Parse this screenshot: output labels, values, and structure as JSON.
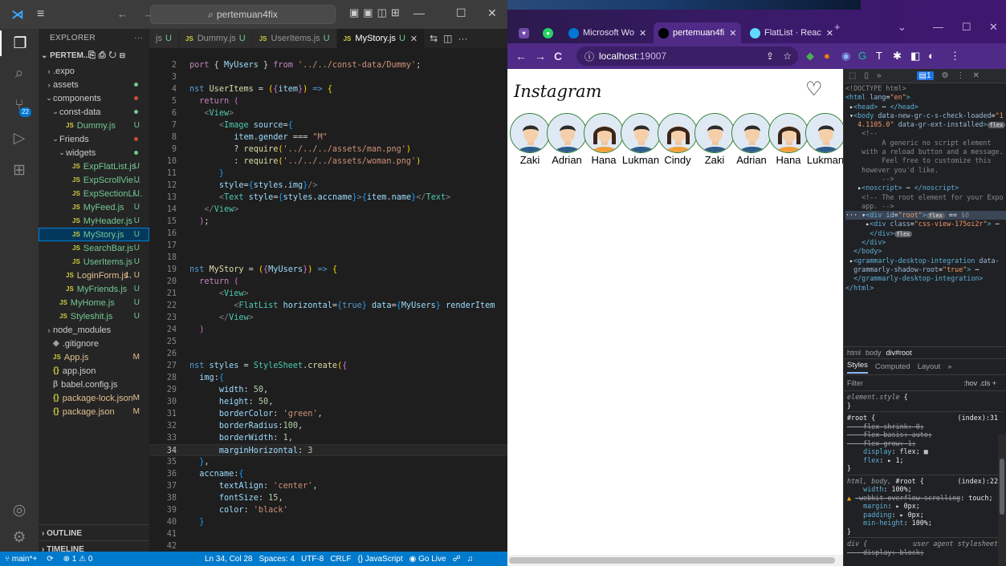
{
  "vscode": {
    "search": "pertemuan4fix",
    "explorer_title": "EXPLORER",
    "project": "PERTEM...",
    "tree": [
      {
        "label": ".expo",
        "indent": 1,
        "chev": "›",
        "status": "",
        "dot": ""
      },
      {
        "label": "assets",
        "indent": 1,
        "chev": "›",
        "status": "",
        "dot": "#73c991"
      },
      {
        "label": "components",
        "indent": 1,
        "chev": "⌄",
        "status": "",
        "dot": "#c74e39"
      },
      {
        "label": "const-data",
        "indent": 2,
        "chev": "⌄",
        "status": "",
        "dot": "#73c991"
      },
      {
        "label": "Dummy.js",
        "indent": 3,
        "chev": "",
        "js": true,
        "status": "U",
        "dot": ""
      },
      {
        "label": "Friends",
        "indent": 2,
        "chev": "⌄",
        "status": "",
        "dot": "#c74e39"
      },
      {
        "label": "widgets",
        "indent": 3,
        "chev": "⌄",
        "status": "",
        "dot": "#73c991"
      },
      {
        "label": "ExpFlatList.js",
        "indent": 4,
        "chev": "",
        "js": true,
        "status": "U",
        "dot": ""
      },
      {
        "label": "ExpScrollVie...",
        "indent": 4,
        "chev": "",
        "js": true,
        "status": "U",
        "dot": ""
      },
      {
        "label": "ExpSectionLi...",
        "indent": 4,
        "chev": "",
        "js": true,
        "status": "U",
        "dot": ""
      },
      {
        "label": "MyFeed.js",
        "indent": 4,
        "chev": "",
        "js": true,
        "status": "U",
        "dot": ""
      },
      {
        "label": "MyHeader.js",
        "indent": 4,
        "chev": "",
        "js": true,
        "status": "U",
        "dot": ""
      },
      {
        "label": "MyStory.js",
        "indent": 4,
        "chev": "",
        "js": true,
        "status": "U",
        "dot": "",
        "selected": true
      },
      {
        "label": "SearchBar.js",
        "indent": 4,
        "chev": "",
        "js": true,
        "status": "U",
        "dot": ""
      },
      {
        "label": "UserItems.js",
        "indent": 4,
        "chev": "",
        "js": true,
        "status": "U",
        "dot": ""
      },
      {
        "label": "LoginForm.js",
        "indent": 3,
        "chev": "",
        "js": true,
        "status": "1, U",
        "dot": "",
        "statusClass": "stat-1U"
      },
      {
        "label": "MyFriends.js",
        "indent": 3,
        "chev": "",
        "js": true,
        "status": "U",
        "dot": ""
      },
      {
        "label": "MyHome.js",
        "indent": 2,
        "chev": "",
        "js": true,
        "status": "U",
        "dot": ""
      },
      {
        "label": "Styleshit.js",
        "indent": 2,
        "chev": "",
        "js": true,
        "status": "U",
        "dot": ""
      },
      {
        "label": "node_modules",
        "indent": 1,
        "chev": "›",
        "status": "",
        "dot": ""
      },
      {
        "label": ".gitignore",
        "indent": 1,
        "chev": "",
        "icon": "◈",
        "status": "",
        "dot": ""
      },
      {
        "label": "App.js",
        "indent": 1,
        "chev": "",
        "js": true,
        "status": "M",
        "dot": "",
        "statusClass": "stat-M"
      },
      {
        "label": "app.json",
        "indent": 1,
        "chev": "",
        "json": true,
        "status": "",
        "dot": ""
      },
      {
        "label": "babel.config.js",
        "indent": 1,
        "chev": "",
        "icon": "β",
        "status": "",
        "dot": ""
      },
      {
        "label": "package-lock.json",
        "indent": 1,
        "chev": "",
        "json": true,
        "status": "M",
        "dot": "",
        "statusClass": "stat-M"
      },
      {
        "label": "package.json",
        "indent": 1,
        "chev": "",
        "json": true,
        "status": "M",
        "dot": "",
        "statusClass": "stat-M"
      }
    ],
    "outline": "OUTLINE",
    "timeline": "TIMELINE",
    "tabs": [
      {
        "label": "js",
        "u": "U",
        "js": false,
        "active": false
      },
      {
        "label": "Dummy.js",
        "u": "U",
        "js": true,
        "active": false
      },
      {
        "label": "UserItems.js",
        "u": "U",
        "js": true,
        "active": false
      },
      {
        "label": "MyStory.js",
        "u": "U",
        "js": true,
        "active": true
      }
    ],
    "status": {
      "branch": "main*+",
      "errors": "⊗ 1 ⚠ 0",
      "position": "Ln 34, Col 28",
      "spaces": "Spaces: 4",
      "encoding": "UTF-8",
      "eol": "CRLF",
      "language": "{} JavaScript",
      "golive": "Go Live"
    }
  },
  "chrome": {
    "tabs": [
      {
        "label": "Microsoft Wo",
        "fav": "#0078d4",
        "active": false
      },
      {
        "label": "pertemuan4fi",
        "fav": "#000",
        "active": true
      },
      {
        "label": "FlatList · Reac",
        "fav": "#61dafb",
        "active": false
      }
    ],
    "url_host": "localhost",
    "url_port": ":19007",
    "page": {
      "logo": "Instagram",
      "stories": [
        {
          "name": "Zaki",
          "gender": "M"
        },
        {
          "name": "Adrian",
          "gender": "M"
        },
        {
          "name": "Hana",
          "gender": "F"
        },
        {
          "name": "Lukman",
          "gender": "M"
        },
        {
          "name": "Cindy",
          "gender": "F"
        },
        {
          "name": "Zaki",
          "gender": "M"
        },
        {
          "name": "Adrian",
          "gender": "M"
        },
        {
          "name": "Hana",
          "gender": "F"
        },
        {
          "name": "Lukman",
          "gender": "M"
        }
      ]
    },
    "devtools": {
      "breadcrumb": [
        "html",
        "body",
        "div#root"
      ],
      "tabs": [
        "Styles",
        "Computed",
        "Layout",
        "»"
      ],
      "filter": "Filter",
      "filter_right": ":hov  .cls  +"
    }
  }
}
